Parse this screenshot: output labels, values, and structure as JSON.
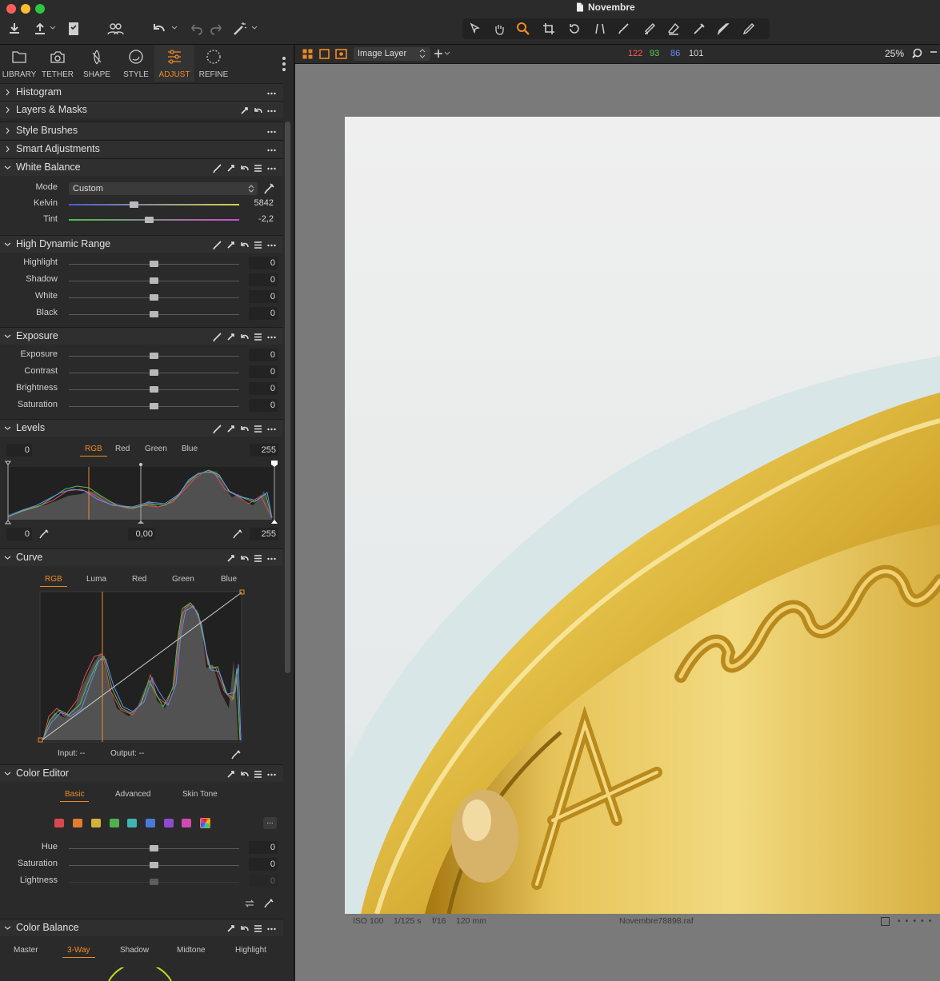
{
  "window": {
    "title": "Novembre"
  },
  "tabs": [
    {
      "label": "LIBRARY",
      "icon": "folder-icon"
    },
    {
      "label": "TETHER",
      "icon": "camera-icon"
    },
    {
      "label": "SHAPE",
      "icon": "lens-icon"
    },
    {
      "label": "STYLE",
      "icon": "palette-icon"
    },
    {
      "label": "ADJUST",
      "icon": "sliders-icon",
      "active": true
    },
    {
      "label": "REFINE",
      "icon": "refine-icon"
    }
  ],
  "sections": {
    "histogram": "Histogram",
    "layers": "Layers & Masks",
    "style_brushes": "Style Brushes",
    "smart_adjustments": "Smart Adjustments",
    "white_balance": "White Balance",
    "hdr": "High Dynamic Range",
    "exposure": "Exposure",
    "levels": "Levels",
    "curve": "Curve",
    "color_editor": "Color Editor",
    "color_balance": "Color Balance"
  },
  "white_balance": {
    "mode_label": "Mode",
    "mode_value": "Custom",
    "kelvin_label": "Kelvin",
    "kelvin_value": "5842",
    "tint_label": "Tint",
    "tint_value": "-2,2"
  },
  "hdr": {
    "rows": [
      {
        "label": "Highlight",
        "value": "0"
      },
      {
        "label": "Shadow",
        "value": "0"
      },
      {
        "label": "White",
        "value": "0"
      },
      {
        "label": "Black",
        "value": "0"
      }
    ]
  },
  "exposure": {
    "rows": [
      {
        "label": "Exposure",
        "value": "0"
      },
      {
        "label": "Contrast",
        "value": "0"
      },
      {
        "label": "Brightness",
        "value": "0"
      },
      {
        "label": "Saturation",
        "value": "0"
      }
    ]
  },
  "levels": {
    "channels": [
      "RGB",
      "Red",
      "Green",
      "Blue"
    ],
    "input_low": "0",
    "input_high": "255",
    "output_low": "0",
    "midtone": "0,00",
    "output_high": "255"
  },
  "curve": {
    "channels": [
      "RGB",
      "Luma",
      "Red",
      "Green",
      "Blue"
    ],
    "input_label": "Input: --",
    "output_label": "Output: --"
  },
  "color_editor": {
    "tabs": [
      "Basic",
      "Advanced",
      "Skin Tone"
    ],
    "more": "...",
    "swatch_colors": [
      "#d9484e",
      "#e07d2f",
      "#d4b23a",
      "#4fb24f",
      "#3fb5b0",
      "#4a7ad8",
      "#8e4ad0",
      "#d14ab0"
    ],
    "rows": [
      {
        "label": "Hue",
        "value": "0"
      },
      {
        "label": "Saturation",
        "value": "0"
      },
      {
        "label": "Lightness",
        "value": "0"
      }
    ]
  },
  "color_balance": {
    "tabs": [
      "Master",
      "3-Way",
      "Shadow",
      "Midtone",
      "Highlight"
    ]
  },
  "viewer": {
    "layer": "Image Layer",
    "r": "122",
    "g": "93",
    "b": "86",
    "l": "101",
    "zoom": "25%",
    "iso": "ISO 100",
    "shutter": "1/125 s",
    "aperture": "f/16",
    "focal": "120 mm",
    "filename": "Novembre78898.raf"
  },
  "colors": {
    "accent": "#f08a24",
    "panel": "#2a2a2a",
    "viewer_bg": "#7a7a7a"
  }
}
